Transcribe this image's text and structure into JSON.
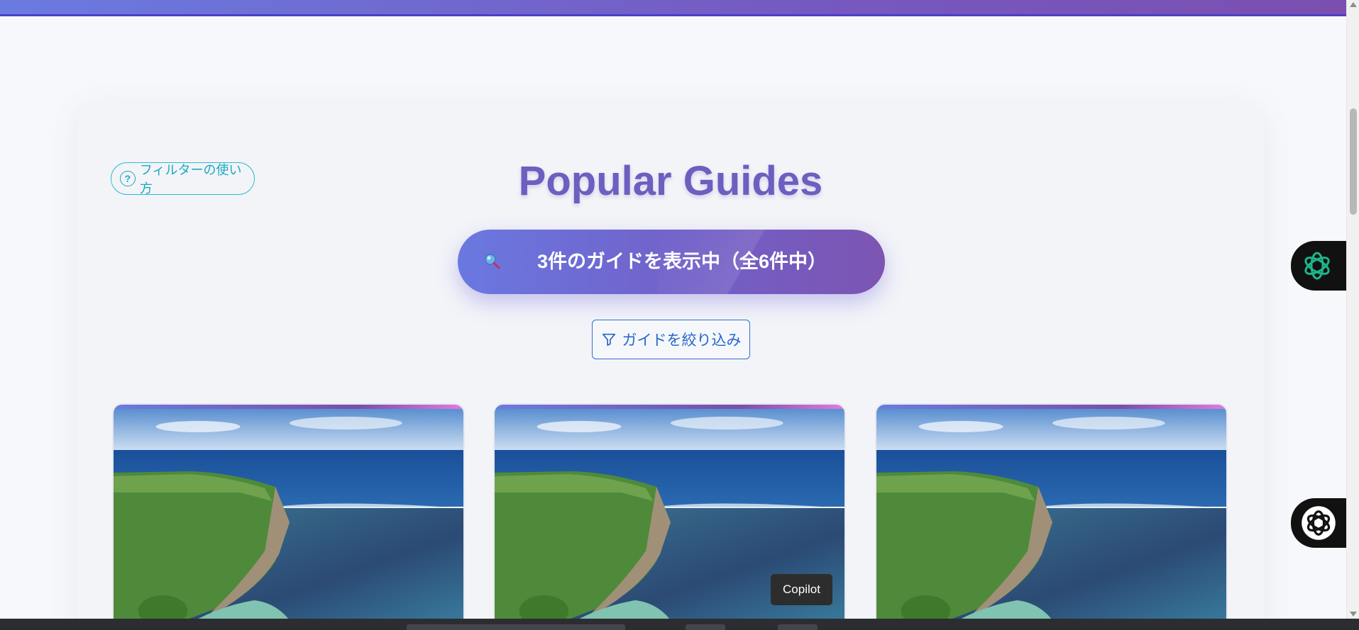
{
  "help": {
    "label": "フィルターの使い方",
    "icon": "question-circle-icon"
  },
  "header": {
    "title": "Popular Guides"
  },
  "status": {
    "text": "3件のガイドを表示中（全6件中）",
    "icon": "magnifier-icon"
  },
  "filter": {
    "label": "ガイドを絞り込み",
    "icon": "funnel-icon"
  },
  "cards": [
    {
      "image": "coastal-cliff-photo"
    },
    {
      "image": "coastal-cliff-photo"
    },
    {
      "image": "coastal-cliff-photo"
    }
  ],
  "sidebar": {
    "buttons": [
      {
        "icon": "chatgpt-green-icon"
      },
      {
        "icon": "openai-icon"
      }
    ]
  },
  "tooltip": {
    "text": "Copilot"
  },
  "colors": {
    "accent": "#6b5fbf",
    "pill_start": "#6a78e0",
    "pill_end": "#7c55b2",
    "help_border": "#2bbcd0",
    "filter_border": "#2f6fd0"
  }
}
